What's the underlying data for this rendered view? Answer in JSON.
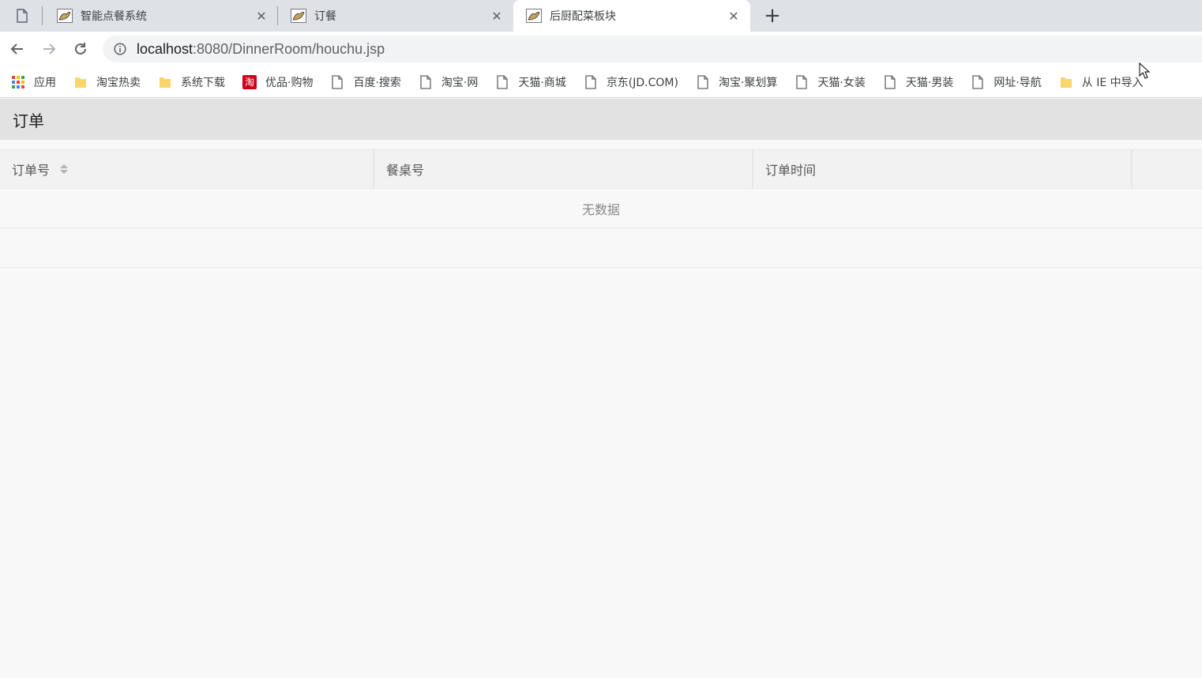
{
  "browser": {
    "tabs": [
      {
        "title": "智能点餐系统",
        "active": false
      },
      {
        "title": "订餐",
        "active": false
      },
      {
        "title": "后厨配菜板块",
        "active": true
      }
    ],
    "close_glyph": "✕",
    "new_tab_glyph": "+",
    "url": {
      "host": "localhost",
      "path": ":8080/DinnerRoom/houchu.jsp"
    },
    "bookmarks": [
      {
        "label": "应用",
        "icon": "apps-grid-icon"
      },
      {
        "label": "淘宝热卖",
        "icon": "folder-icon"
      },
      {
        "label": "系统下载",
        "icon": "folder-icon"
      },
      {
        "label": "优品·购物",
        "icon": "taobao-icon"
      },
      {
        "label": "百度·搜索",
        "icon": "page-icon"
      },
      {
        "label": "淘宝·网",
        "icon": "page-icon"
      },
      {
        "label": "天猫·商城",
        "icon": "page-icon"
      },
      {
        "label": "京东(JD.COM)",
        "icon": "page-icon"
      },
      {
        "label": "淘宝·聚划算",
        "icon": "page-icon"
      },
      {
        "label": "天猫·女装",
        "icon": "page-icon"
      },
      {
        "label": "天猫·男装",
        "icon": "page-icon"
      },
      {
        "label": "网址·导航",
        "icon": "page-icon"
      },
      {
        "label": "从 IE 中导入",
        "icon": "folder-icon"
      }
    ],
    "taobao_glyph": "淘"
  },
  "panel": {
    "title": "订单",
    "columns": [
      "订单号",
      "餐桌号",
      "订单时间",
      ""
    ],
    "empty_text": "无数据"
  },
  "colors": {
    "folder": "#f9d56b",
    "taobao": "#d0021b",
    "apps": [
      "#ea4335",
      "#fbbc05",
      "#34a853",
      "#4285f4"
    ]
  }
}
